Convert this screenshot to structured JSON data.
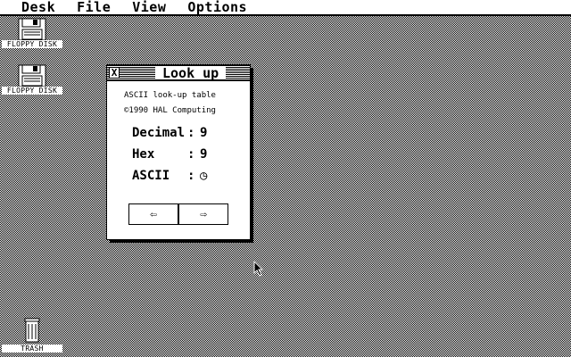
{
  "menubar": {
    "items": [
      {
        "label": "Desk"
      },
      {
        "label": "File"
      },
      {
        "label": "View"
      },
      {
        "label": "Options"
      }
    ]
  },
  "desktop": {
    "icons": [
      {
        "label": "FLOPPY DISK",
        "icon": "floppy-drive-icon"
      },
      {
        "label": "FLOPPY DISK",
        "icon": "floppy-drive-icon"
      },
      {
        "label": "TRASH",
        "icon": "trash-can-icon"
      }
    ]
  },
  "window": {
    "title": "Look up",
    "close_glyph": "X",
    "subtitle": "ASCII look-up table",
    "copyright": "©1990 HAL Computing",
    "fields": [
      {
        "label": "Decimal",
        "colon": ":",
        "value": "9"
      },
      {
        "label": "Hex",
        "colon": ":",
        "value": "9"
      },
      {
        "label": "ASCII",
        "colon": ":",
        "value": "◷"
      }
    ],
    "prev_glyph": "⇦",
    "next_glyph": "⇨"
  }
}
